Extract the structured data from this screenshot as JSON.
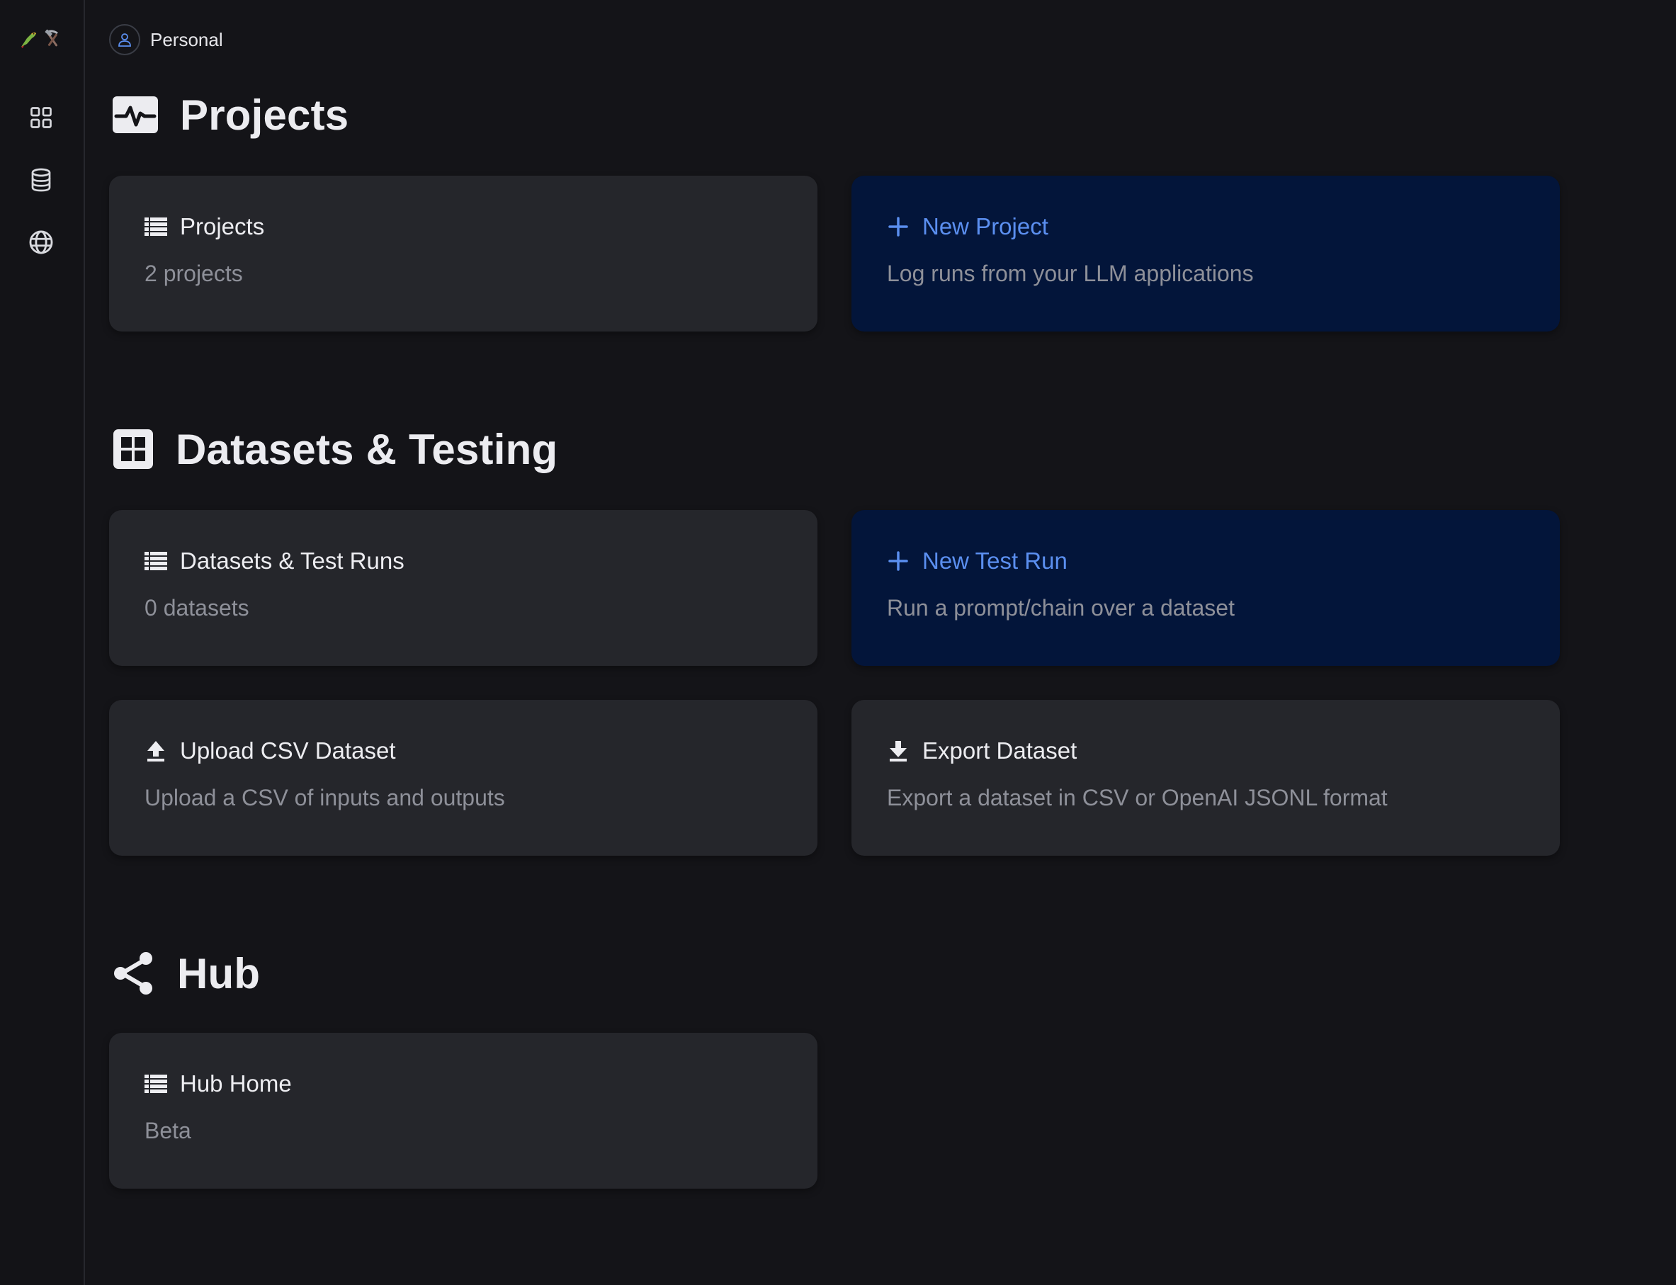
{
  "app": {
    "logo_icons": [
      "parrot-icon",
      "hammer-pick-icon"
    ],
    "workspace": "Personal"
  },
  "sidebar": {
    "items": [
      {
        "icon": "grid-icon"
      },
      {
        "icon": "database-icon"
      },
      {
        "icon": "globe-icon"
      }
    ]
  },
  "sections": {
    "projects": {
      "title": "Projects",
      "icon": "activity-icon",
      "cards": {
        "list": {
          "title": "Projects",
          "subtitle": "2 projects",
          "icon": "list-icon"
        },
        "new": {
          "title": "New Project",
          "subtitle": "Log runs from your LLM applications",
          "icon": "plus-icon"
        }
      }
    },
    "datasets": {
      "title": "Datasets & Testing",
      "icon": "grid-box-icon",
      "cards": {
        "list": {
          "title": "Datasets & Test Runs",
          "subtitle": "0 datasets",
          "icon": "list-icon"
        },
        "new": {
          "title": "New Test Run",
          "subtitle": "Run a prompt/chain over a dataset",
          "icon": "plus-icon"
        },
        "upload": {
          "title": "Upload CSV Dataset",
          "subtitle": "Upload a CSV of inputs and outputs",
          "icon": "upload-icon"
        },
        "export": {
          "title": "Export Dataset",
          "subtitle": "Export a dataset in CSV or OpenAI JSONL format",
          "icon": "download-icon"
        }
      }
    },
    "hub": {
      "title": "Hub",
      "icon": "share-icon",
      "cards": {
        "home": {
          "title": "Hub Home",
          "subtitle": "Beta",
          "icon": "list-icon"
        }
      }
    }
  },
  "colors": {
    "background": "#141418",
    "card": "#25262b",
    "primary_card": "#03153a",
    "accent": "#5b8ff0",
    "muted_text": "#8e9099"
  }
}
